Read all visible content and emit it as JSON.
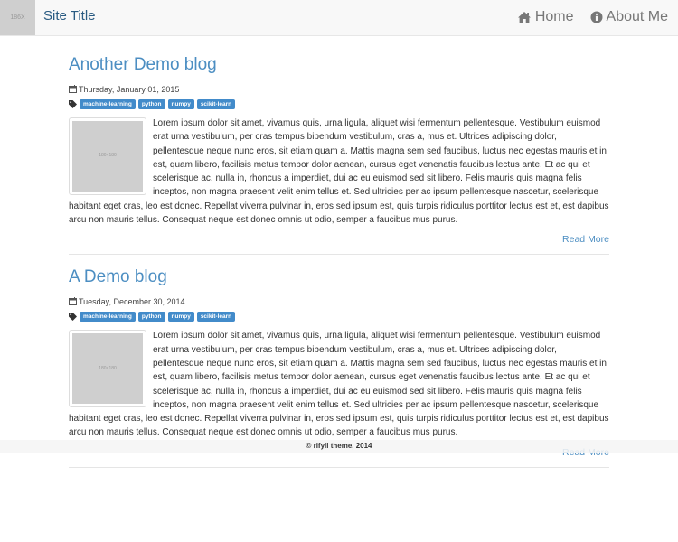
{
  "nav": {
    "logo_text": "186X",
    "site_title": "Site Title",
    "links": [
      {
        "label": "Home",
        "icon": "home-icon"
      },
      {
        "label": "About Me",
        "icon": "info-circle-icon"
      }
    ]
  },
  "posts": [
    {
      "title": "Another Demo blog",
      "date": "Thursday, January 01, 2015",
      "tags": [
        "machine-learning",
        "python",
        "numpy",
        "scikit-learn"
      ],
      "thumbnail_text": "180×180",
      "body": "Lorem ipsum dolor sit amet, vivamus quis, urna ligula, aliquet wisi fermentum pellentesque. Vestibulum euismod erat urna vestibulum, per cras tempus bibendum vestibulum, cras a, mus et. Ultrices adipiscing dolor, pellentesque neque nunc eros, sit etiam quam a. Mattis magna sem sed faucibus, luctus nec egestas mauris et in est, quam libero, facilisis metus tempor dolor aenean, cursus eget venenatis faucibus lectus ante. Et ac qui et scelerisque ac, nulla in, rhoncus a imperdiet, dui ac eu euismod sed sit libero. Felis mauris quis magna felis inceptos, non magna praesent velit enim tellus et. Sed ultricies per ac ipsum pellentesque nascetur, scelerisque habitant eget cras, leo est donec. Repellat viverra pulvinar in, eros sed ipsum est, quis turpis ridiculus porttitor lectus est et, est dapibus arcu non mauris tellus. Consequat neque est donec omnis ut odio, semper a faucibus mus purus.",
      "read_more": "Read More"
    },
    {
      "title": "A Demo blog",
      "date": "Tuesday, December 30, 2014",
      "tags": [
        "machine-learning",
        "python",
        "numpy",
        "scikit-learn"
      ],
      "thumbnail_text": "180×180",
      "body": "Lorem ipsum dolor sit amet, vivamus quis, urna ligula, aliquet wisi fermentum pellentesque. Vestibulum euismod erat urna vestibulum, per cras tempus bibendum vestibulum, cras a, mus et. Ultrices adipiscing dolor, pellentesque neque nunc eros, sit etiam quam a. Mattis magna sem sed faucibus, luctus nec egestas mauris et in est, quam libero, facilisis metus tempor dolor aenean, cursus eget venenatis faucibus lectus ante. Et ac qui et scelerisque ac, nulla in, rhoncus a imperdiet, dui ac eu euismod sed sit libero. Felis mauris quis magna felis inceptos, non magna praesent velit enim tellus et. Sed ultricies per ac ipsum pellentesque nascetur, scelerisque habitant eget cras, leo est donec. Repellat viverra pulvinar in, eros sed ipsum est, quis turpis ridiculus porttitor lectus est et, est dapibus arcu non mauris tellus. Consequat neque est donec omnis ut odio, semper a faucibus mus purus.",
      "read_more": "Read More"
    }
  ],
  "footer": {
    "text": "© rifyll theme, 2014"
  },
  "colors": {
    "accent": "#4c8ec2",
    "tag_bg": "#428bca",
    "nav_bg": "#f8f8f8"
  }
}
